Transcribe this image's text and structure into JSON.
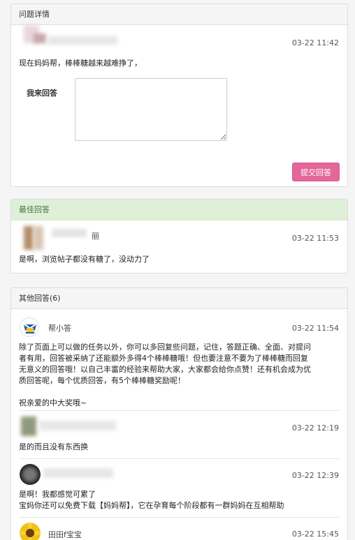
{
  "question": {
    "header": "问题详情",
    "time": "03-22 11:42",
    "text": "现在妈妈帮，棒棒糖越来越难挣了，",
    "answer_label": "我来回答",
    "answer_placeholder": "",
    "submit_label": "提交回答"
  },
  "best_answer": {
    "header": "最佳回答",
    "name": "丽",
    "time": "03-22 11:53",
    "text": "是啊，浏览帖子都没有糖了，没动力了"
  },
  "other_answers": {
    "header": "其他回答(6)",
    "items": [
      {
        "name": "帮小答",
        "time": "03-22 11:54",
        "lines": [
          "除了页面上可以做的任务以外，你可以多回复些问题，记住，答题正确、全面、对提问",
          "者有用，回答被采纳了还能额外多得4个棒棒糖哦！但也要注意不要为了棒棒糖而回复",
          "无意义的回答哦！以自己丰富的经验来帮助大家，大家都会给你点赞！还有机会成为优",
          "质回答呢，每个优质回答，有5个棒棒糖奖励呢！",
          "",
          "祝亲爱的中大奖哦~"
        ]
      },
      {
        "name": "",
        "time": "03-22 12:19",
        "lines": [
          "是的而且没有东西换"
        ]
      },
      {
        "name": "",
        "time": "03-22 12:39",
        "lines": [
          "是啊！我都感觉可累了",
          "宝妈你还可以免费下载【妈妈帮】，它在孕育每个阶段都有一群妈妈在互相帮助"
        ]
      },
      {
        "name": "田田f宝宝",
        "time": "03-22 15:45",
        "lines": []
      }
    ]
  },
  "colors": {
    "accent": "#e3679a",
    "best_bg": "#dff0d8",
    "best_text": "#3c763d"
  }
}
